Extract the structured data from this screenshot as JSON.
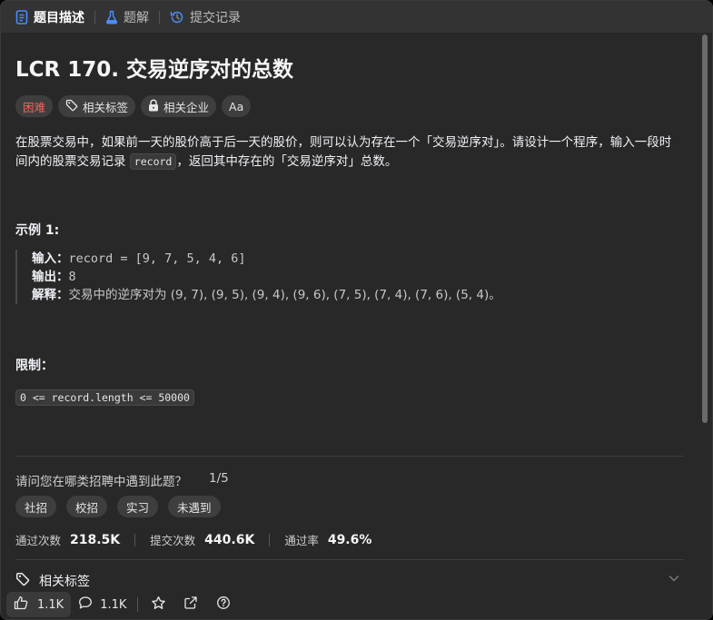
{
  "tabs": [
    {
      "label": "题目描述",
      "icon": "document-icon",
      "active": true
    },
    {
      "label": "题解",
      "icon": "flask-icon",
      "active": false
    },
    {
      "label": "提交记录",
      "icon": "history-icon",
      "active": false
    }
  ],
  "problem": {
    "title": "LCR 170. 交易逆序对的总数",
    "difficulty": "困难",
    "tags_label": "相关标签",
    "companies_label": "相关企业",
    "font_toggle_label": "Aa",
    "desc_part1": "在股票交易中，如果前一天的股价高于后一天的股价，则可以认为存在一个「交易逆序对」。请设计一个程序，输入一段时间内的股票交易记录 ",
    "desc_code": "record",
    "desc_part2": "，返回其中存在的「交易逆序对」总数。"
  },
  "example": {
    "heading": "示例 1:",
    "input_label": "输入：",
    "input_value": "record = [9, 7, 5, 4, 6]",
    "output_label": "输出：",
    "output_value": "8",
    "explain_label": "解释：",
    "explain_value": "交易中的逆序对为 (9, 7), (9, 5), (9, 4), (9, 6), (7, 5), (7, 4), (7, 6), (5, 4)。"
  },
  "constraints": {
    "heading": "限制：",
    "items": [
      "0 <= record.length <= 50000"
    ]
  },
  "survey": {
    "question": "请问您在哪类招聘中遇到此题？",
    "progress": "1/5",
    "options": [
      "社招",
      "校招",
      "实习",
      "未遇到"
    ]
  },
  "stats": {
    "accepted_label": "通过次数",
    "accepted_value": "218.5K",
    "submissions_label": "提交次数",
    "submissions_value": "440.6K",
    "rate_label": "通过率",
    "rate_value": "49.6%"
  },
  "related_tags_label": "相关标签",
  "bottom": {
    "likes": "1.1K",
    "comments": "1.1K"
  },
  "colors": {
    "background": "#282828",
    "tabbar": "#333333",
    "hard": "#f8615c",
    "pill": "#3e3e3e",
    "tab_active_icon": "#4a8cf7",
    "flask_icon": "#4a8cf7"
  }
}
